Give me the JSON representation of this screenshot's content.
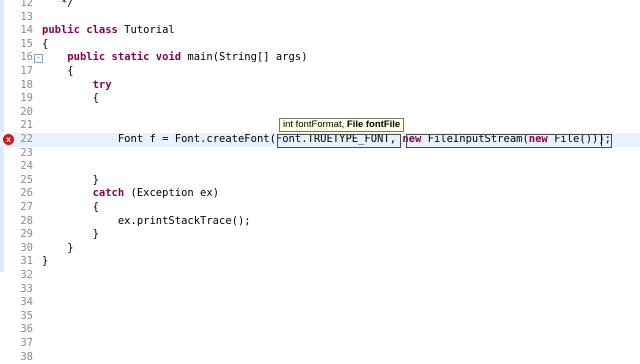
{
  "editor": {
    "lines": [
      {
        "num": "12",
        "text": "   */"
      },
      {
        "num": "13",
        "text": ""
      },
      {
        "num": "14",
        "kw": "public class",
        "text": " Tutorial"
      },
      {
        "num": "15",
        "text": "{"
      },
      {
        "num": "16",
        "pre": "    ",
        "kw": "public static void",
        "text": " main(String[] args)"
      },
      {
        "num": "17",
        "text": "    {"
      },
      {
        "num": "18",
        "pre": "        ",
        "kw": "try",
        "text": ""
      },
      {
        "num": "19",
        "text": "        {"
      },
      {
        "num": "20",
        "text": ""
      },
      {
        "num": "21",
        "text": ""
      },
      {
        "num": "22",
        "text": ""
      },
      {
        "num": "23",
        "text": ""
      },
      {
        "num": "24",
        "text": ""
      },
      {
        "num": "25",
        "text": "        }"
      },
      {
        "num": "26",
        "pre": "        ",
        "kw": "catch",
        "text": " (Exception ex)"
      },
      {
        "num": "27",
        "text": "        {"
      },
      {
        "num": "28",
        "text": "            ex.printStackTrace();"
      },
      {
        "num": "29",
        "text": "        }"
      },
      {
        "num": "30",
        "text": "    }"
      },
      {
        "num": "31",
        "text": "}"
      },
      {
        "num": "32",
        "text": ""
      },
      {
        "num": "33",
        "text": ""
      },
      {
        "num": "34",
        "text": ""
      },
      {
        "num": "35",
        "text": ""
      },
      {
        "num": "36",
        "text": ""
      },
      {
        "num": "37",
        "text": ""
      },
      {
        "num": "38",
        "text": ""
      }
    ],
    "current_line": {
      "num": "22",
      "part1": "            Font ",
      "var": "f",
      "part2": " = Font.createFont(Font.TRUETYPE_FONT, ",
      "kw_new1": "new",
      "part3": " FileInputStream(",
      "kw_new2": "new",
      "part4": " File(",
      "part5": "))",
      "part6": ");"
    },
    "fold_symbol": "⊖",
    "error_symbol": "x"
  },
  "tooltip": {
    "param1": "int fontFormat, ",
    "param2": "File fontFile"
  }
}
